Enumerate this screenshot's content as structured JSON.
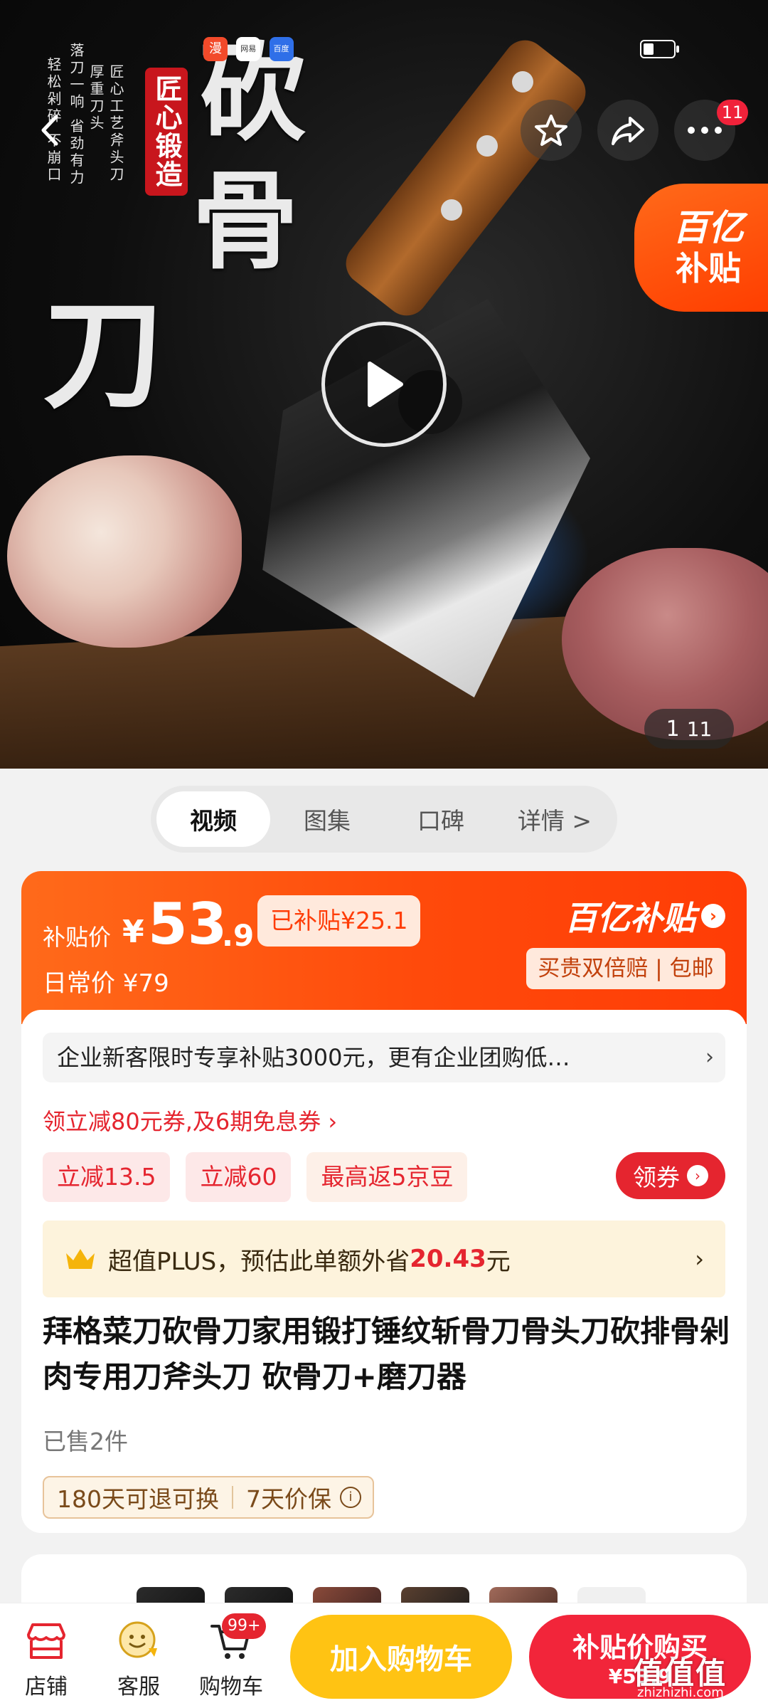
{
  "status_bar": {
    "left_icons": [
      "漫",
      "网易",
      "百度"
    ]
  },
  "hero": {
    "calligraphy_main": [
      "砍",
      "骨",
      "刀"
    ],
    "seal_text": "匠心锻造",
    "calligraphy_small": [
      "匠心工艺斧头刀",
      "厚重刀头",
      "落刀一响 省劲有力",
      "轻松剁碎 不崩口"
    ],
    "badge_count": "11",
    "subsidy_tag_line1": "百亿",
    "subsidy_tag_line2": "补贴",
    "image_index": "1",
    "image_total": "11"
  },
  "tabs": [
    {
      "label": "视频",
      "active": true
    },
    {
      "label": "图集",
      "active": false
    },
    {
      "label": "口碑",
      "active": false
    },
    {
      "label": "详情 >",
      "active": false
    }
  ],
  "price": {
    "label": "补贴价",
    "currency": "¥",
    "integer": "53",
    "decimal": ".9",
    "saved": "已补贴¥25.1",
    "regular": "日常价 ¥79",
    "brand": "百亿补贴",
    "guarantee": "买贵双倍赔 | 包邮"
  },
  "promo": {
    "enterprise": "企业新客限时专享补贴3000元，更有企业团购低…",
    "coupon_link": "领立减80元券,及6期免息券 ›",
    "chips": [
      "立减13.5",
      "立减60",
      "最高返5京豆"
    ],
    "get_coupon": "领券"
  },
  "plus": {
    "prefix": "超值PLUS，预估此单额外省",
    "amount": "20.43",
    "suffix": "元"
  },
  "product": {
    "title": "拜格菜刀砍骨刀家用锻打锤纹斩骨刀骨头刀砍排骨剁肉专用刀斧头刀 砍骨刀+磨刀器",
    "sold": "已售2件",
    "service_1": "180天可退可换",
    "service_2": "7天价保"
  },
  "bottom_bar": {
    "store": "店铺",
    "service": "客服",
    "cart": "购物车",
    "cart_badge": "99+",
    "add_to_cart": "加入购物车",
    "buy_line1": "补贴价购买",
    "buy_line2": "¥53.9"
  },
  "watermark": {
    "main": "值值值",
    "sub": "zhizhizhi.com"
  },
  "colors": {
    "accent_orange": "#ff4a0b",
    "accent_red": "#e5252f",
    "cart_yellow": "#ffc313"
  }
}
